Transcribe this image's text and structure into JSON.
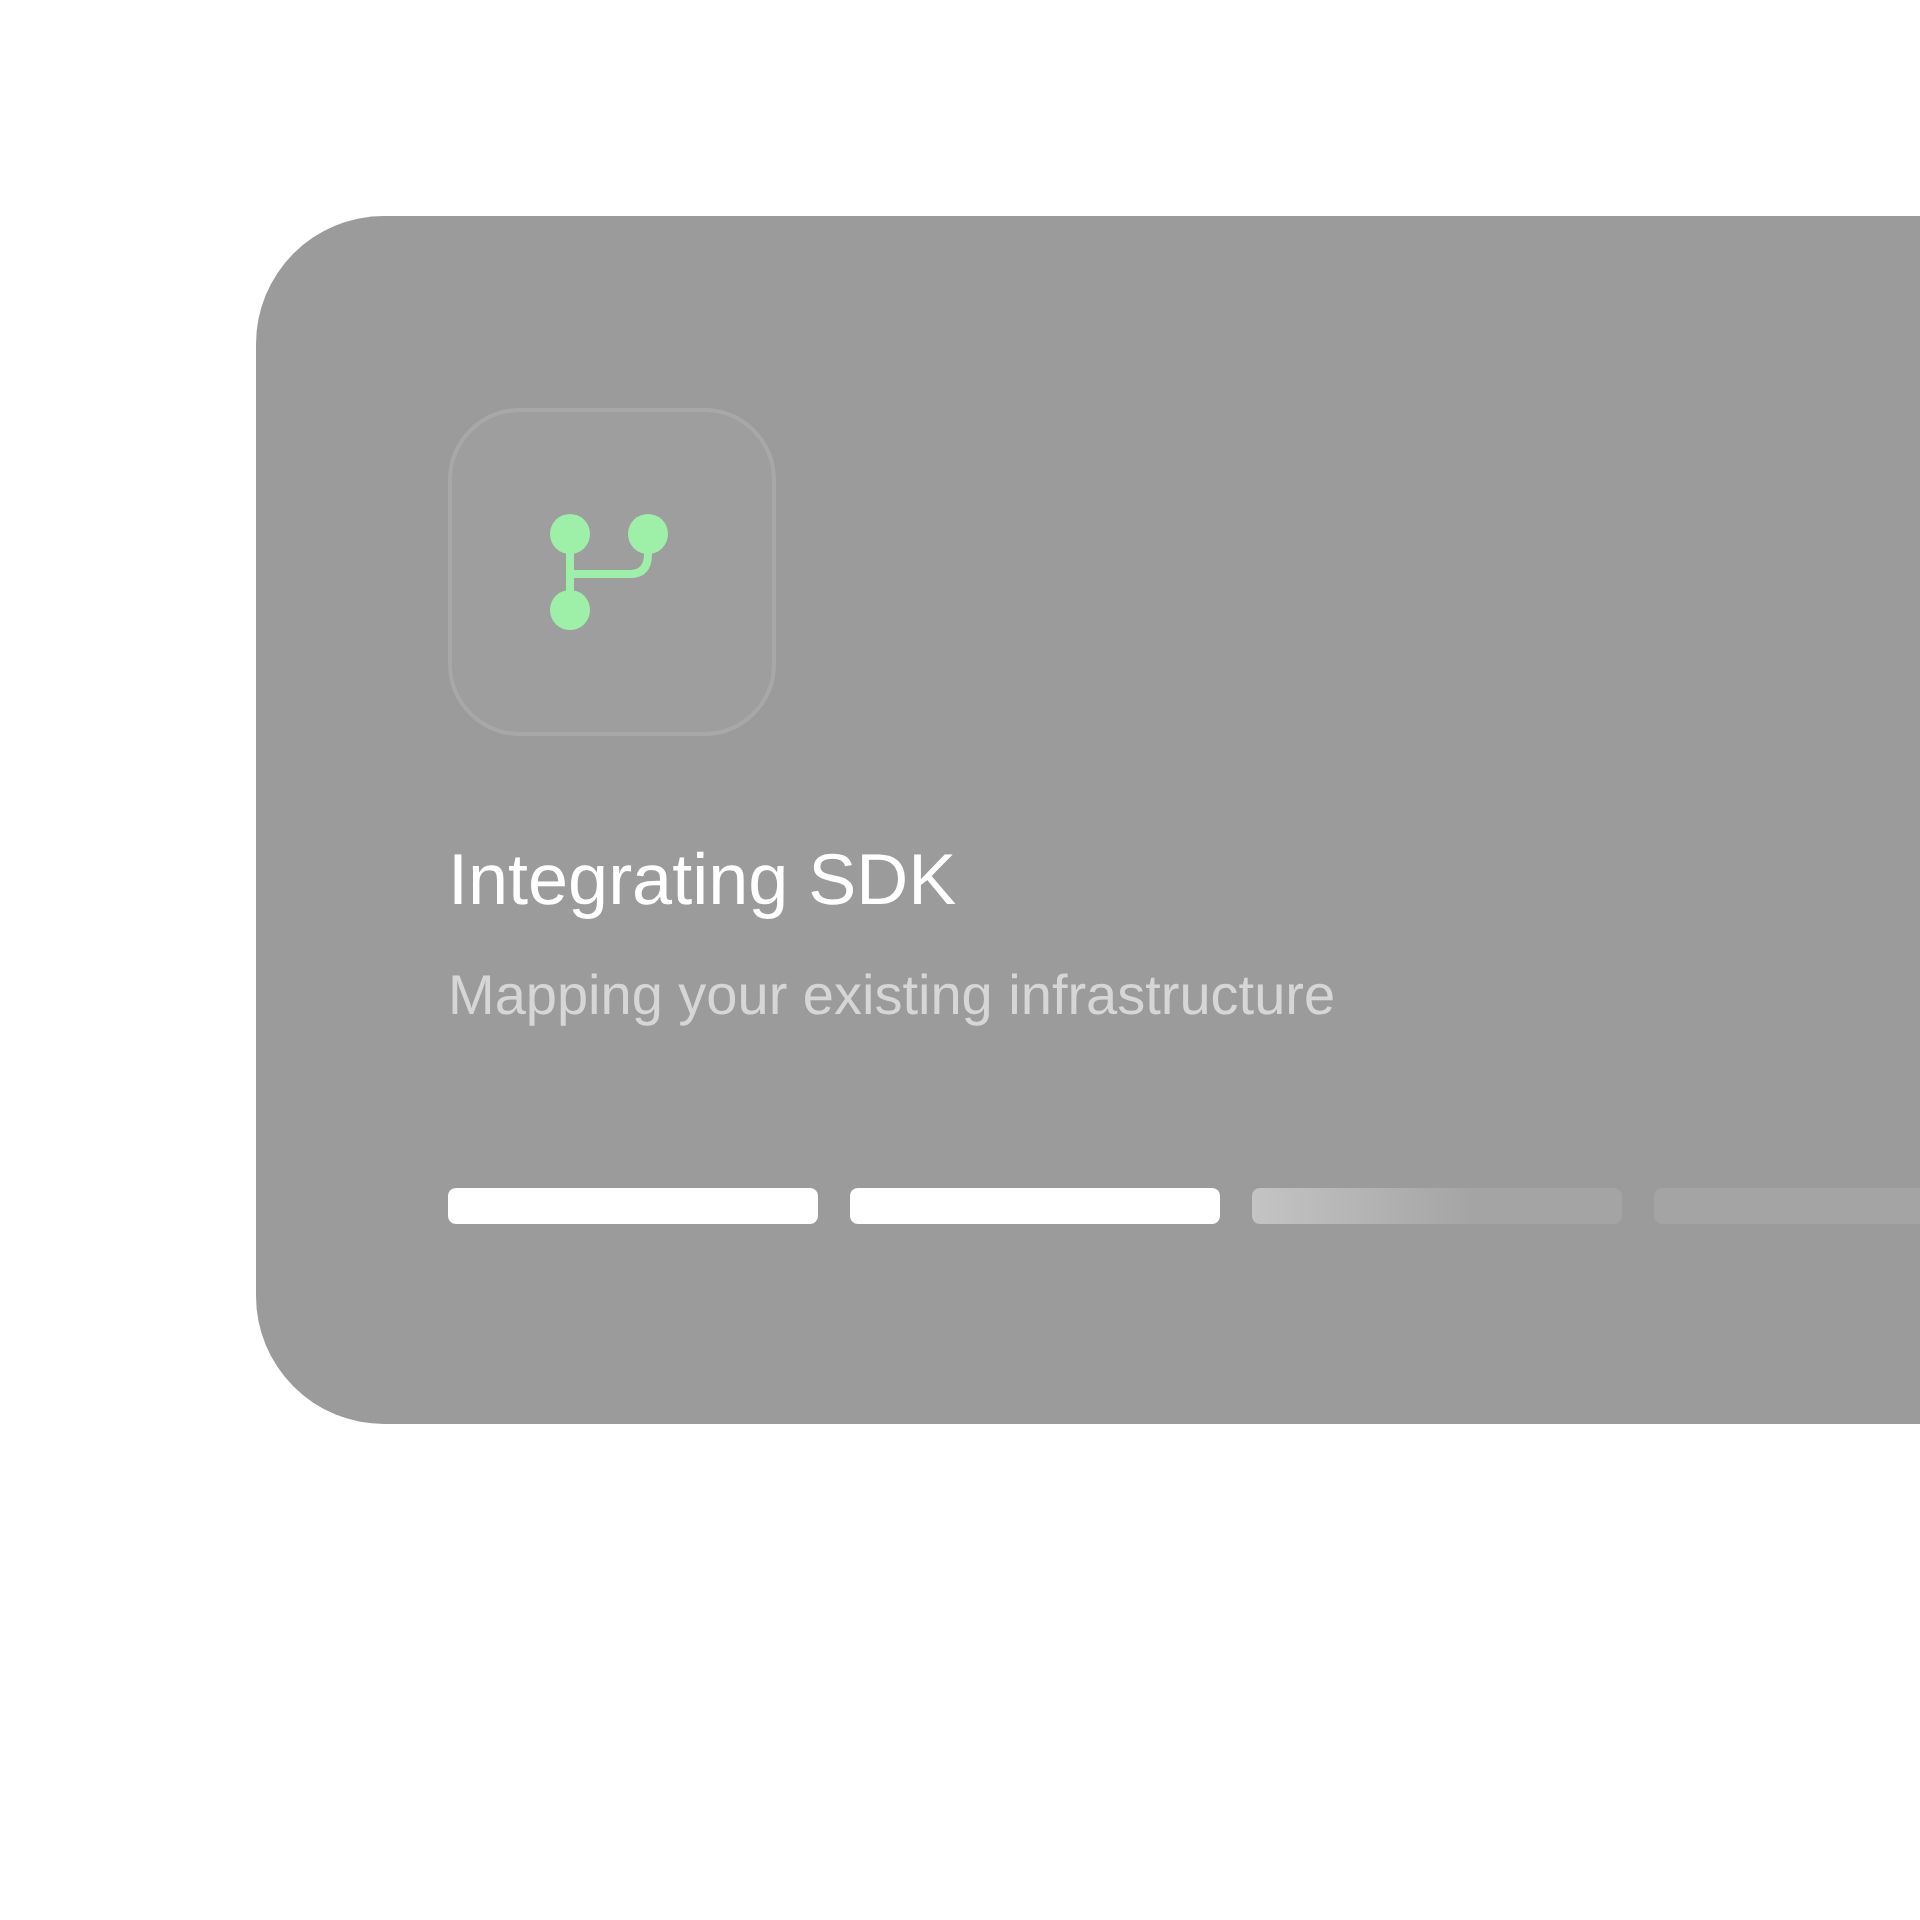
{
  "card": {
    "title": "Integrating SDK",
    "subtitle": "Mapping your existing infrastructure",
    "steps": [
      {
        "level": 1
      },
      {
        "level": 1
      },
      {
        "level": 0.6
      },
      {
        "level": 0
      }
    ]
  }
}
